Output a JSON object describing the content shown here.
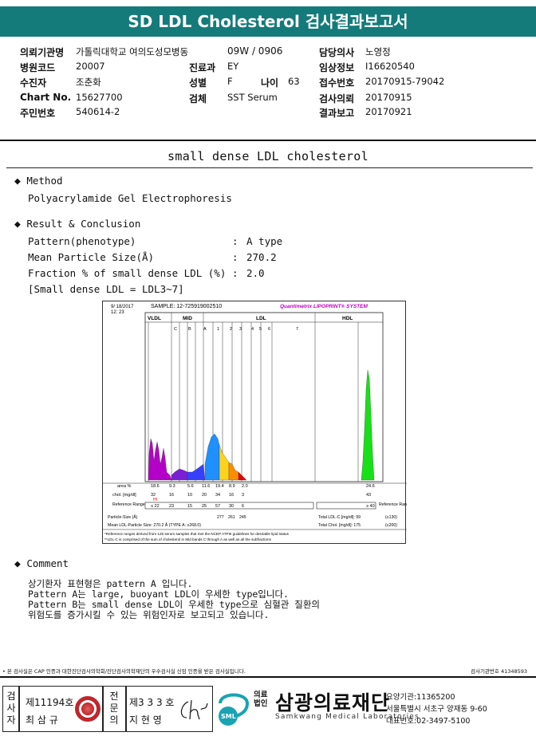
{
  "header": {
    "title": "SD LDL Cholesterol 검사결과보고서"
  },
  "info": {
    "institution_label": "의뢰기관명",
    "institution": "가톨릭대학교 여의도성모병동",
    "ward_code": "09W / 0906",
    "doctor_label": "담당의사",
    "doctor": "노영정",
    "hospital_code_label": "병원코드",
    "hospital_code": "20007",
    "dept_label": "진료과",
    "dept": "EY",
    "clinical_label": "임상정보",
    "clinical": "I16620540",
    "patient_label": "수진자",
    "patient": "조춘화",
    "sex_label": "성별",
    "sex": "F",
    "age_label": "나이",
    "age": "63",
    "receipt_label": "접수번호",
    "receipt": "20170915-79042",
    "chart_label": "Chart No.",
    "chart": "15627700",
    "specimen_label": "검체",
    "specimen": "SST Serum",
    "request_label": "검사의뢰",
    "request_date": "20170915",
    "id_label": "주민번호",
    "id": "540614-2",
    "report_label": "결과보고",
    "report_date": "20170921"
  },
  "section": {
    "title": "small dense LDL cholesterol"
  },
  "method": {
    "heading": "Method",
    "text": "Polyacrylamide Gel Electrophoresis"
  },
  "result": {
    "heading": "Result & Conclusion",
    "rows": [
      {
        "label": "Pattern(phenotype)",
        "colon": ":",
        "value": "A type"
      },
      {
        "label": "Mean Particle Size(Å)",
        "colon": ":",
        "value": "270.2"
      },
      {
        "label": "Fraction % of small dense LDL (%)",
        "colon": ":",
        "value": "2.0"
      }
    ],
    "note": "[Small dense LDL = LDL3~7]"
  },
  "lipoprint": {
    "date": "9/ 18/2017",
    "time": "12: 23",
    "sample": "SAMPLE:  12-725919002510",
    "brand": "Quantimetrix LIPOPRINT® SYSTEM",
    "groups": [
      "VLDL",
      "MID",
      "LDL",
      "HDL"
    ],
    "bands": [
      "C",
      "B",
      "A",
      "1",
      "2",
      "3",
      "4",
      "5",
      "6",
      "7"
    ],
    "row_area_label": "area %",
    "area": [
      "18.6",
      "9.3",
      "5.6",
      "11.6",
      "19.4",
      "8.9",
      "2.0",
      "24.6"
    ],
    "row_chol_label": "chol. [mg/dl]",
    "chol": [
      "32",
      "16",
      "10",
      "20",
      "34",
      "16",
      "3",
      "43"
    ],
    "hi": "HI",
    "row_ref_label": "Reference Range",
    "ref": [
      "≤ 22",
      "23",
      "15",
      "25",
      "57",
      "30",
      "6",
      "≥ 40"
    ],
    "particle_size": "Particle-Size (Å)",
    "sizes": [
      "277",
      "261",
      "245"
    ],
    "mean_size": "Mean LDL-Particle Size:   270.2 Å   (TYPE A: ≥268.0)",
    "total_ldl": "Total LDL-C [mg/dl]:  99",
    "total_ldl_ref": "(≤130)",
    "total_chol": "Total Chol. [mg/dl]:  175",
    "total_chol_ref": "(≤200)",
    "note1": "*Reference ranges derived from 125 serum samples that met the NCEP ATPIII guidelines for desirable lipid status",
    "note2": "**LDL-C is comprised of the sum of cholesterol in Mid bands C through A as well as all the subfractions",
    "colors": {
      "vldl": "#b400c8",
      "mid_c": "#7a1fd4",
      "mid_b": "#3540ff",
      "ldl1": "#1e90ff",
      "ldl2": "#ffd21e",
      "ldl3": "#ff8c00",
      "ldl4": "#e60000",
      "hdl": "#18e018"
    }
  },
  "comment": {
    "heading": "Comment",
    "lines": [
      "상기환자 표현형은 pattern A 입니다.",
      "Pattern A는 large, buoyant LDL이 우세한 type입니다.",
      "Pattern B는 small dense LDL이 우세한 type으로 심혈관 질환의",
      "위험도를 증가시킬 수 있는 위험인자로 보고되고 있습니다."
    ]
  },
  "footer": {
    "notice": "• 본 검사실은 CAP 인증과 대한진단검사의학회/진단검사의학재단의 우수검사실 신임 인증을 받은 검사실입니다.",
    "page_ref": "검사기관번호 41348593",
    "box1_vert": "검사자",
    "box1_no": "제11194호",
    "box1_name": "최 삼 규",
    "box2_vert": "전문의",
    "box2_no": "제3 3 3 호",
    "box2_name": "지 현 영",
    "org_prefix": "의료법인",
    "org_name": "삼광의료재단",
    "org_en": "Samkwang Medical Laboratories",
    "logo": "SML",
    "org_code": "요양기관:11365200",
    "org_address": "서울특별시 서초구 양재동 9-60",
    "org_phone": "대표번호:02-3497-5100"
  }
}
